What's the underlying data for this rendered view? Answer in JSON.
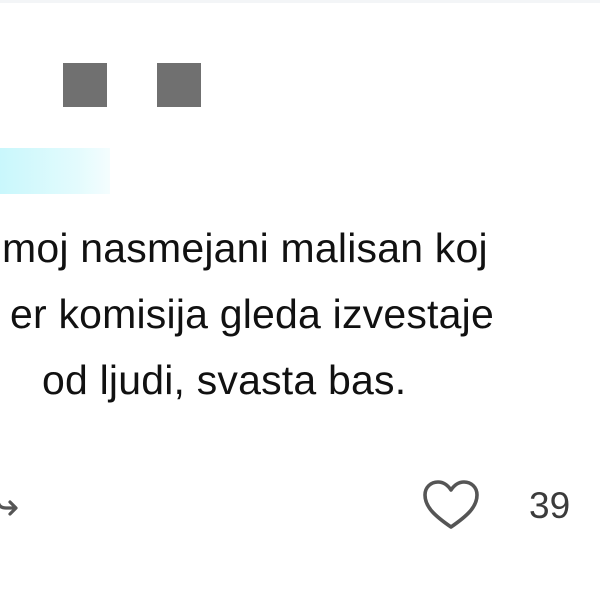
{
  "tweet": {
    "lines": [
      "moj nasmejani malisan koj",
      "er komisija gleda izvestaje",
      "od ljudi, svasta bas."
    ]
  },
  "actions": {
    "retweet_icon": "retweet-icon",
    "like_icon": "heart-icon",
    "like_count": "39"
  },
  "colors": {
    "redaction": "#707070",
    "mention_highlight": "#c9f7fc",
    "text": "#111111",
    "action_text": "#3b3b3b"
  }
}
